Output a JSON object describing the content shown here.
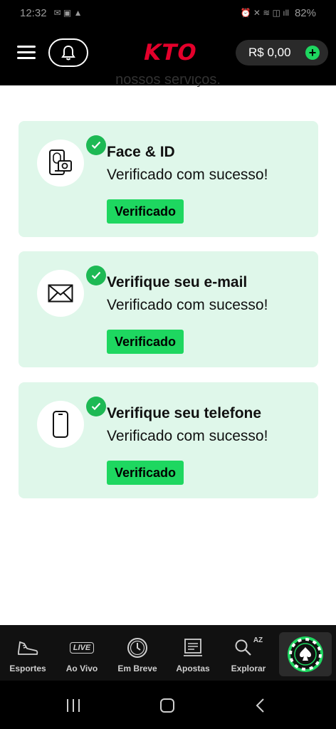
{
  "status_bar": {
    "time": "12:32",
    "battery": "82%"
  },
  "header": {
    "logo": "KTO",
    "balance": "R$ 0,00",
    "add_symbol": "+"
  },
  "partial_heading": "nossos serviços.",
  "cards": [
    {
      "title": "Face & ID",
      "status": "Verificado com sucesso!",
      "badge": "Verificado",
      "icon": "face-id-phone-icon"
    },
    {
      "title": "Verifique seu e-mail",
      "status": "Verificado com sucesso!",
      "badge": "Verificado",
      "icon": "envelope-icon"
    },
    {
      "title": "Verifique seu telefone",
      "status": "Verificado com sucesso!",
      "badge": "Verificado",
      "icon": "phone-icon"
    }
  ],
  "bottom_nav": [
    {
      "label": "Esportes",
      "icon": "sneaker-icon"
    },
    {
      "label": "Ao Vivo",
      "icon": "live-icon",
      "icon_text": "LIVE"
    },
    {
      "label": "Em Breve",
      "icon": "clock-icon"
    },
    {
      "label": "Apostas",
      "icon": "betslip-icon"
    },
    {
      "label": "Explorar",
      "icon": "search-az-icon",
      "icon_text": "AZ"
    }
  ],
  "colors": {
    "accent": "#1ed760",
    "logo": "#e4002b",
    "card_bg": "#dff7ea",
    "header_bg": "#000000"
  }
}
